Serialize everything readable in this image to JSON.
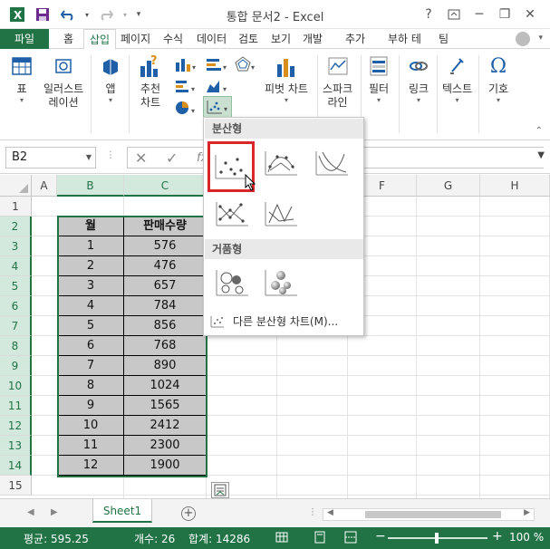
{
  "window": {
    "title": "통합 문서2 - Excel",
    "help_label": "?",
    "minimize_label": "─",
    "restore_label": "❐",
    "close_label": "✕"
  },
  "tabs": [
    {
      "label": "파일"
    },
    {
      "label": "홈"
    },
    {
      "label": "삽입"
    },
    {
      "label": "페이지"
    },
    {
      "label": "수식"
    },
    {
      "label": "데이터"
    },
    {
      "label": "검토"
    },
    {
      "label": "보기"
    },
    {
      "label": "개발"
    },
    {
      "label": "추가"
    },
    {
      "label": "부하 테"
    },
    {
      "label": "팀"
    }
  ],
  "ribbon": {
    "table": "표",
    "illustrations": [
      "일러스트",
      "레이션"
    ],
    "apps": "앱",
    "recommended_charts": [
      "추천",
      "차트"
    ],
    "pivot_chart": "피벗 차트",
    "sparklines": [
      "스파크",
      "라인"
    ],
    "filters": "필터",
    "links": "링크",
    "text": "텍스트",
    "symbols": "기호"
  },
  "formula_bar": {
    "name_box": "B2",
    "cancel": "✕",
    "enter": "✓",
    "fx": "fx"
  },
  "columns": [
    "A",
    "B",
    "C",
    "D",
    "E",
    "F",
    "G",
    "H"
  ],
  "rows": [
    "1",
    "2",
    "3",
    "4",
    "5",
    "6",
    "7",
    "8",
    "9",
    "10",
    "11",
    "12",
    "13",
    "14",
    "15"
  ],
  "table": {
    "headers": [
      "월",
      "판매수량"
    ],
    "rows": [
      [
        "1",
        "576"
      ],
      [
        "2",
        "476"
      ],
      [
        "3",
        "657"
      ],
      [
        "4",
        "784"
      ],
      [
        "5",
        "856"
      ],
      [
        "6",
        "768"
      ],
      [
        "7",
        "890"
      ],
      [
        "8",
        "1024"
      ],
      [
        "9",
        "1565"
      ],
      [
        "10",
        "2412"
      ],
      [
        "11",
        "2300"
      ],
      [
        "12",
        "1900"
      ]
    ]
  },
  "scatter_menu": {
    "section_scatter": "분산형",
    "section_bubble": "거품형",
    "more": "다른 분산형 차트(M)..."
  },
  "sheet": {
    "tab": "Sheet1",
    "add": "+"
  },
  "status": {
    "average": "평균: 595.25",
    "count": "개수: 26",
    "sum": "합계: 14286",
    "zoom": "100 %",
    "zoom_minus": "−",
    "zoom_plus": "+"
  },
  "colors": {
    "excel_green": "#217346",
    "highlight_red": "#d8262a",
    "data_fill": "#c8c8c8"
  }
}
